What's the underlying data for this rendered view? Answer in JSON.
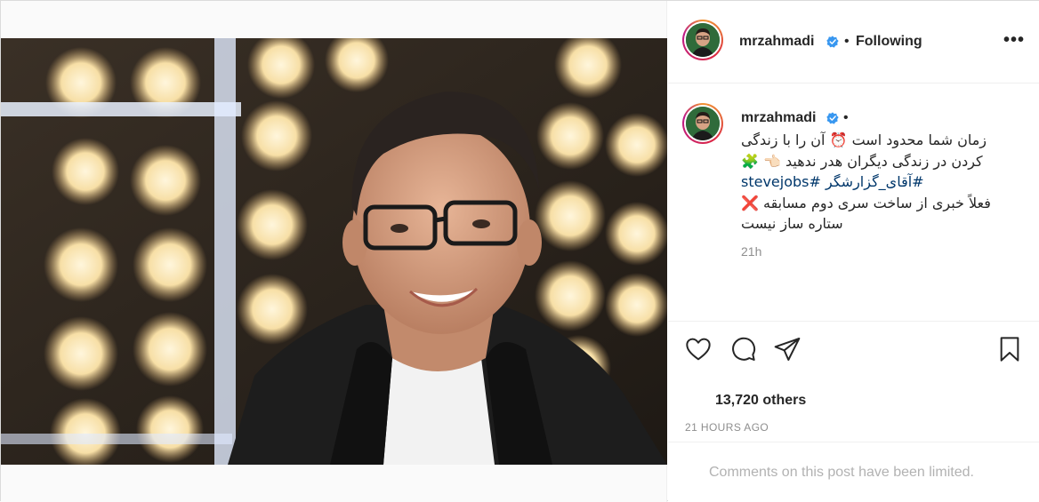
{
  "post": {
    "username": "mrzahmadi",
    "follow_status": "Following",
    "separator": "•",
    "more_label": "•••"
  },
  "caption": {
    "username": "mrzahmadi",
    "separator": "•",
    "line1": "زمان شما محدود است ⏰ آن را با زندگی",
    "line2": "کردن در زندگی دیگران هدر ندهید 👈🏻 🧩",
    "hashtags": "#آقای_گزارشگر #stevejobs",
    "line4": "فعلاً خبری از ساخت سری دوم مسابقه ❌",
    "line5": "ستاره ساز نیست",
    "time": "21h"
  },
  "actions": {
    "like": "heart-icon",
    "comment": "comment-icon",
    "share": "share-icon",
    "save": "bookmark-icon"
  },
  "likes_text": "13,720 others",
  "posted_ago": "21 HOURS AGO",
  "comments_limited": "Comments on this post have been limited.",
  "colors": {
    "verified": "#3897f0",
    "hashtag": "#00376b",
    "muted": "#8e8e8e",
    "border": "#efefef"
  }
}
